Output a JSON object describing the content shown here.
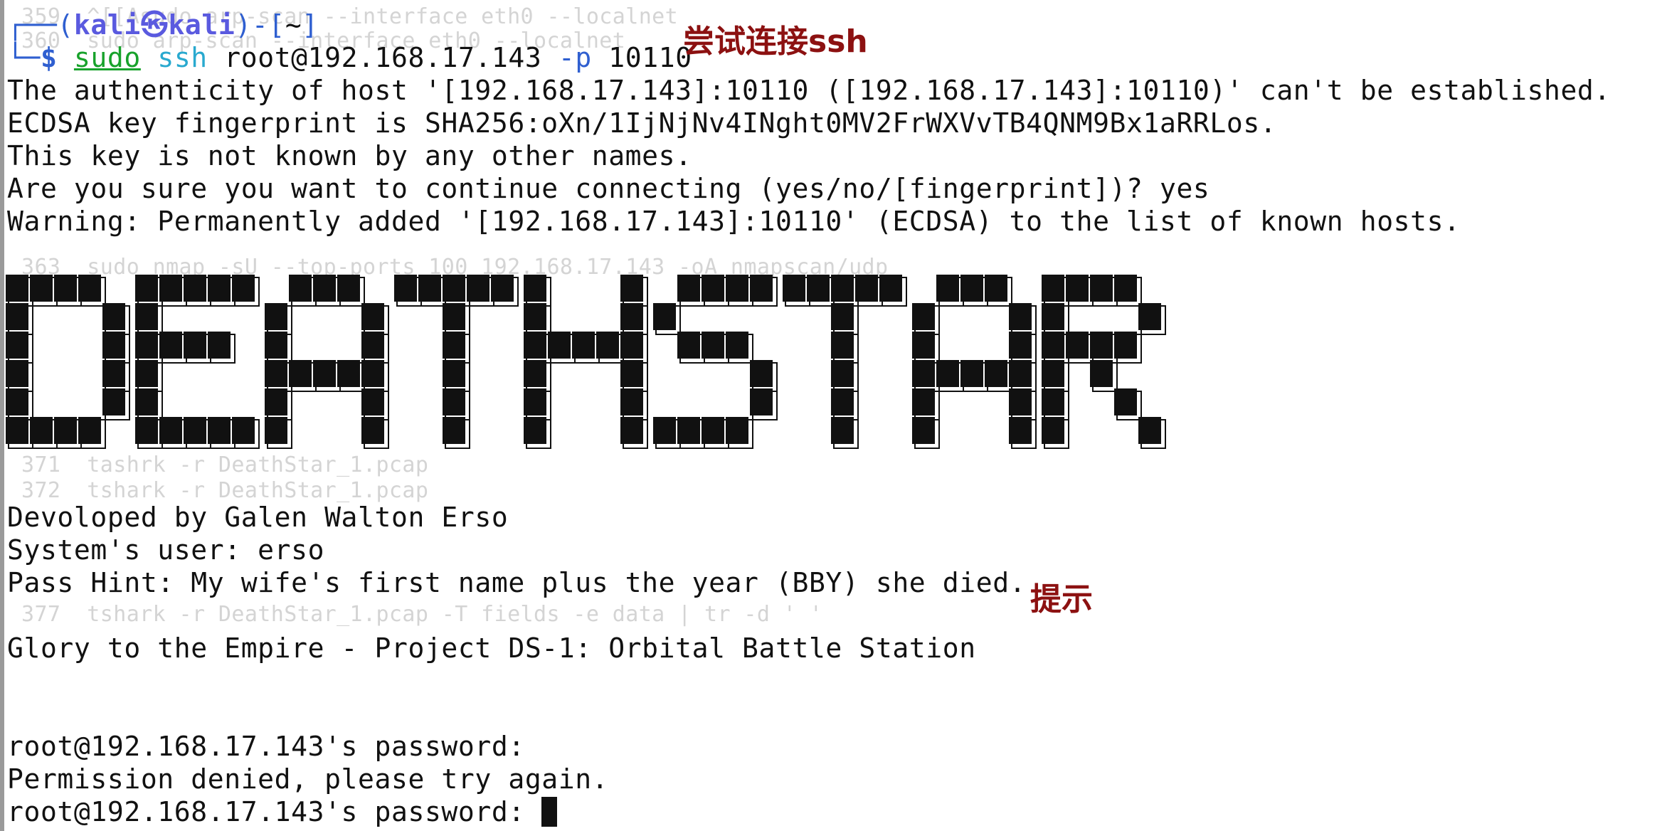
{
  "colors": {
    "background": "#ffffff",
    "prompt_blue": "#2f5fd0",
    "prompt_user": "#5a5adf",
    "sudo_green": "#18a22b",
    "ssh_cyan": "#29a9cf",
    "annotation_red": "#8c1111",
    "faint_text": "#d4d4d4"
  },
  "annotations": {
    "ssh_note": "尝试连接ssh",
    "hint_note": "提示"
  },
  "prompt": {
    "line1_open": "┌──(",
    "user": "kali",
    "sep_icon": "kali-logo-icon",
    "sep_glyph": "㉿",
    "host": "kali",
    "line1_close": ")-[",
    "path": "~",
    "line1_end": "]",
    "line2_frame": "└─",
    "dollar": "$",
    "cmd_sudo": "sudo",
    "cmd_ssh": "ssh",
    "cmd_target": "root@192.168.17.143",
    "cmd_flag": "-p",
    "cmd_port": "10110"
  },
  "output": {
    "auth_warning": "The authenticity of host '[192.168.17.143]:10110 ([192.168.17.143]:10110)' can't be established.",
    "fingerprint": "ECDSA key fingerprint is SHA256:oXn/1IjNjNv4INght0MV2FrWXVvTB4QNM9Bx1aRRLos.",
    "not_known": "This key is not known by any other names.",
    "continue_q": "Are you sure you want to continue connecting (yes/no/[fingerprint])? yes",
    "added": "Warning: Permanently added '[192.168.17.143]:10110' (ECDSA) to the list of known hosts.",
    "banner_text": "DEATHSTAR",
    "developed": "Devoloped by Galen Walton Erso",
    "system_user": "System's user: erso",
    "pass_hint": "Pass Hint: My wife's first name plus the year (BBY) she died.",
    "glory": "Glory to the Empire - Project DS-1: Orbital Battle Station",
    "pw_prompt1": "root@192.168.17.143's password:",
    "denied": "Permission denied, please try again.",
    "pw_prompt2": "root@192.168.17.143's password: "
  },
  "background_history": [
    "359  ^[[Asudo arp-scan --interface eth0 --localnet",
    "360  sudo arp-scan --interface eth0 --localnet",
    "363  sudo nmap -sU --top-ports 100 192.168.17.143 -oA nmapscan/udp",
    "371  tashrk -r DeathStar_1.pcap",
    "372  tshark -r DeathStar_1.pcap",
    "377  tshark -r DeathStar_1.pcap -T fields -e data | tr -d ' '"
  ]
}
